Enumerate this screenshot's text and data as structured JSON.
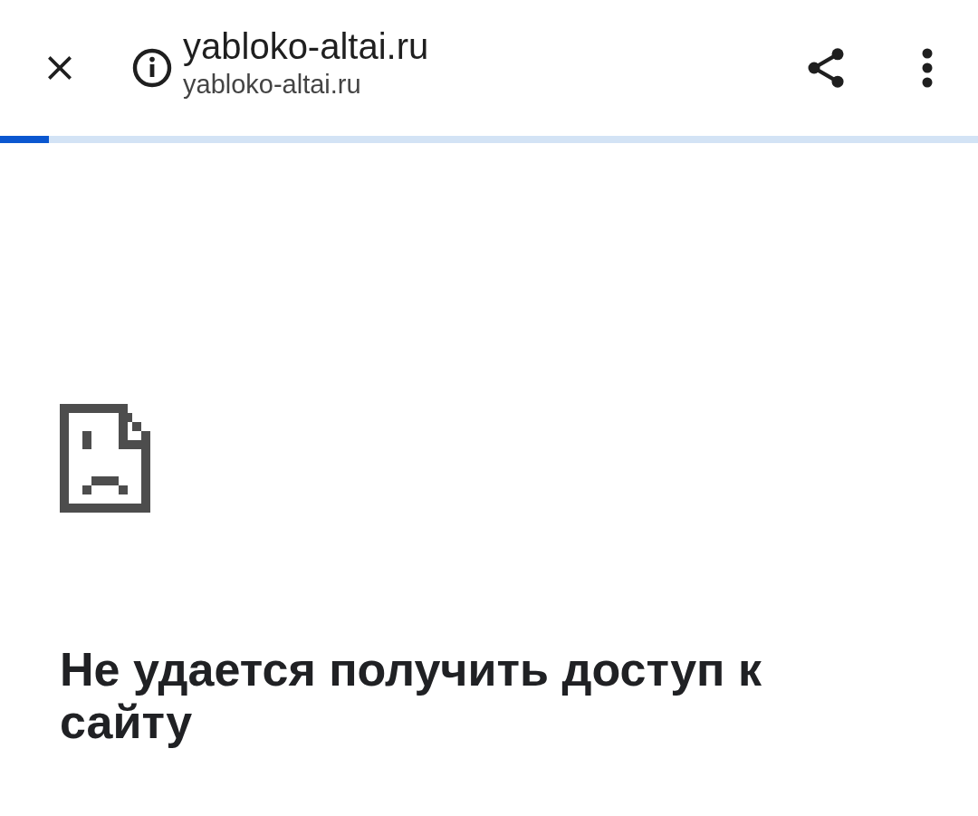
{
  "toolbar": {
    "title": "yabloko-altai.ru",
    "url": "yabloko-altai.ru"
  },
  "progress": {
    "level": 0.05
  },
  "error": {
    "heading": "Не удается получить доступ к сайту"
  }
}
